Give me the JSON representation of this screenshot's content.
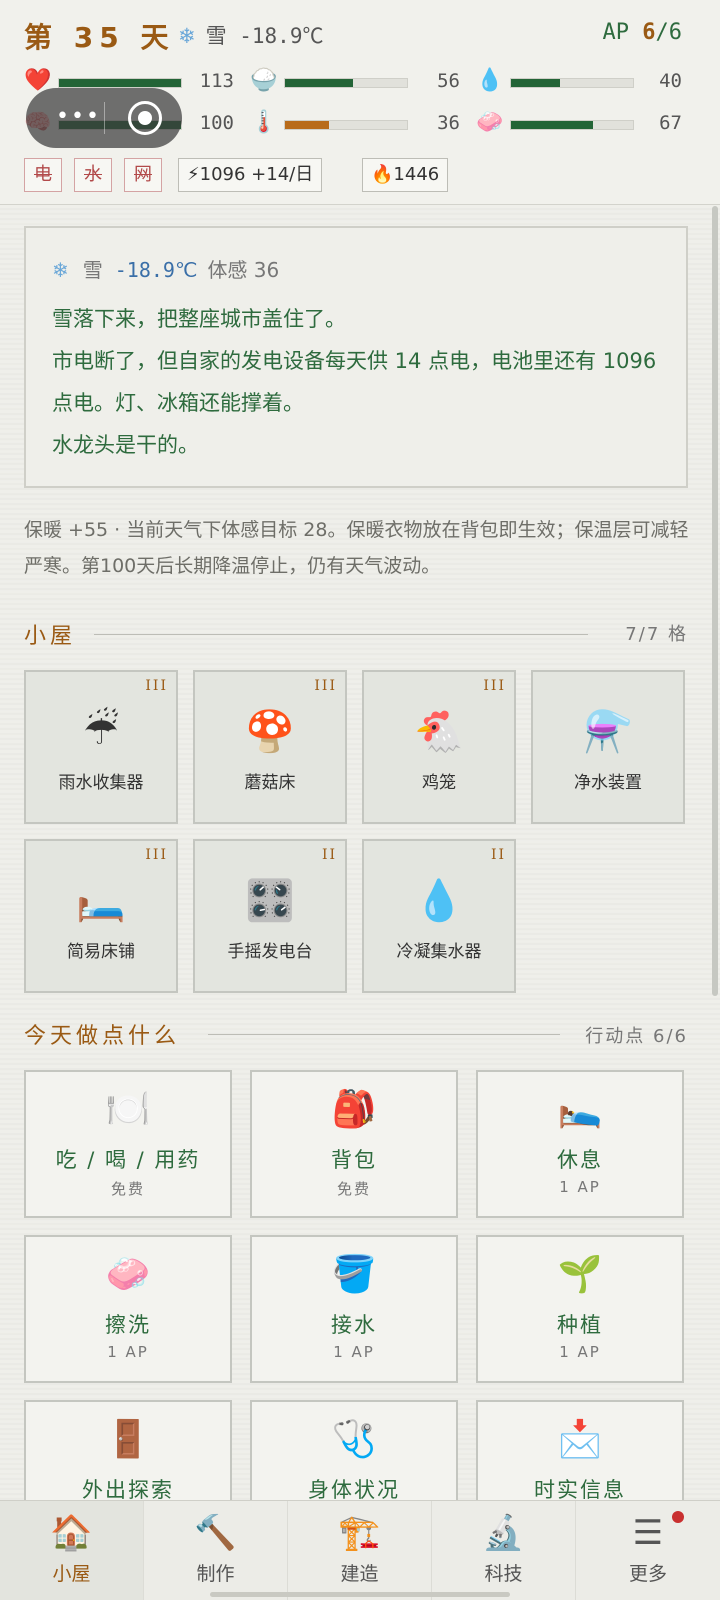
{
  "header": {
    "day_label": "第 35 天",
    "weather_icon": "❄",
    "weather": "雪 -18.9℃",
    "ap_prefix": "AP",
    "ap_current": "6",
    "ap_total": "/6"
  },
  "stats": [
    {
      "icon": "heart-icon",
      "glyph": "❤️",
      "value": "113",
      "fraction": 1.0,
      "color": "#236436"
    },
    {
      "icon": "rice-icon",
      "glyph": "🍚",
      "value": "56",
      "fraction": 0.56,
      "color": "#236436"
    },
    {
      "icon": "water-drop-icon",
      "glyph": "💧",
      "value": "40",
      "fraction": 0.4,
      "color": "#236436"
    },
    {
      "icon": "brain-icon",
      "glyph": "🧠",
      "value": "100",
      "fraction": 1.0,
      "color": "#236436"
    },
    {
      "icon": "thermometer-icon",
      "glyph": "🌡️",
      "value": "36",
      "fraction": 0.36,
      "color": "#b86b1a"
    },
    {
      "icon": "soap-icon",
      "glyph": "🧼",
      "value": "67",
      "fraction": 0.67,
      "color": "#236436"
    }
  ],
  "chips": {
    "power": "电",
    "water": "水",
    "net": "网",
    "battery": "⚡1096 +14/日",
    "fire": "🔥1446"
  },
  "weather_box": {
    "icon": "❄",
    "condition": "雪",
    "temp": "-18.9℃",
    "feel_label": "体感 36",
    "lines": [
      "雪落下来，把整座城市盖住了。",
      "市电断了，但自家的发电设备每天供 14 点电，电池里还有 1096 点电。灯、冰箱还能撑着。",
      "水龙头是干的。"
    ]
  },
  "tip": "保暖 +55 · 当前天气下体感目标 28。保暖衣物放在背包即生效；保温层可减轻严寒。第100天后长期降温停止，仍有天气波动。",
  "hut": {
    "title": "小屋",
    "capacity": "7/7 格",
    "items": [
      {
        "name": "雨水收集器",
        "level": "III",
        "emoji": "☔"
      },
      {
        "name": "蘑菇床",
        "level": "III",
        "emoji": "🍄"
      },
      {
        "name": "鸡笼",
        "level": "III",
        "emoji": "🐔"
      },
      {
        "name": "净水装置",
        "level": "",
        "emoji": "⚗️"
      },
      {
        "name": "简易床铺",
        "level": "III",
        "emoji": "🛏️"
      },
      {
        "name": "手摇发电台",
        "level": "II",
        "emoji": "🎛️"
      },
      {
        "name": "冷凝集水器",
        "level": "II",
        "emoji": "💧"
      }
    ]
  },
  "actions": {
    "title": "今天做点什么",
    "points": "行动点 6/6",
    "items": [
      {
        "name": "吃 / 喝 / 用药",
        "cost": "免费",
        "emoji": "🍽️"
      },
      {
        "name": "背包",
        "cost": "免费",
        "emoji": "🎒"
      },
      {
        "name": "休息",
        "cost": "1 AP",
        "emoji": "🛌"
      },
      {
        "name": "擦洗",
        "cost": "1 AP",
        "emoji": "🧼"
      },
      {
        "name": "接水",
        "cost": "1 AP",
        "emoji": "🪣"
      },
      {
        "name": "种植",
        "cost": "1 AP",
        "emoji": "🌱"
      },
      {
        "name": "外出探索",
        "cost": "",
        "emoji": "🚪"
      },
      {
        "name": "身体状况",
        "cost": "",
        "emoji": "🩺"
      },
      {
        "name": "时实信息",
        "cost": "",
        "emoji": "📩"
      }
    ]
  },
  "nav": [
    {
      "label": "小屋",
      "emoji": "🏠"
    },
    {
      "label": "制作",
      "emoji": "🔨"
    },
    {
      "label": "建造",
      "emoji": "🏗️"
    },
    {
      "label": "科技",
      "emoji": "🔬"
    },
    {
      "label": "更多",
      "emoji": "☰"
    }
  ]
}
